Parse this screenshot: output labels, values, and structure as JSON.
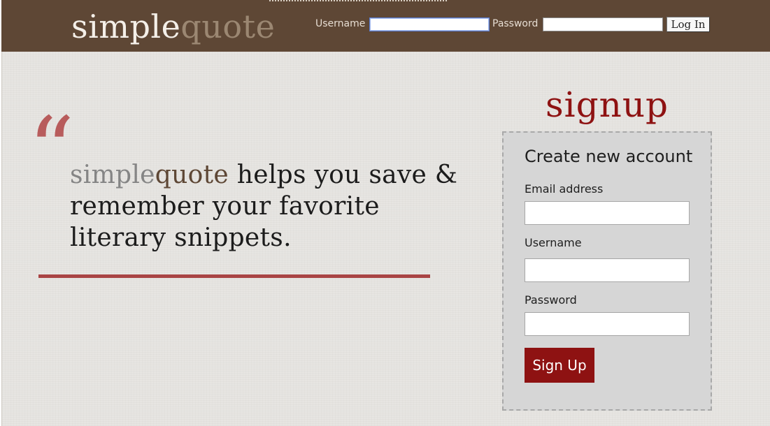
{
  "header": {
    "logo_simple": "simple",
    "logo_quote": "quote",
    "username_label": "Username",
    "username_value": "",
    "password_label": "Password",
    "password_value": "",
    "login_button": "Log In"
  },
  "hero": {
    "quote_mark": "“",
    "brand_simple": "simple",
    "brand_quote": "quote",
    "tagline_rest": " helps you save & remember your favorite literary snippets."
  },
  "signup": {
    "title": "signup",
    "heading": "Create new account",
    "email_label": "Email address",
    "email_value": "",
    "username_label": "Username",
    "username_value": "",
    "password_label": "Password",
    "password_value": "",
    "submit_label": "Sign Up"
  },
  "colors": {
    "header_bg": "#5e4735",
    "accent_red": "#8e1212",
    "rule_red": "#a94444",
    "quote_brown": "#5e4735"
  }
}
